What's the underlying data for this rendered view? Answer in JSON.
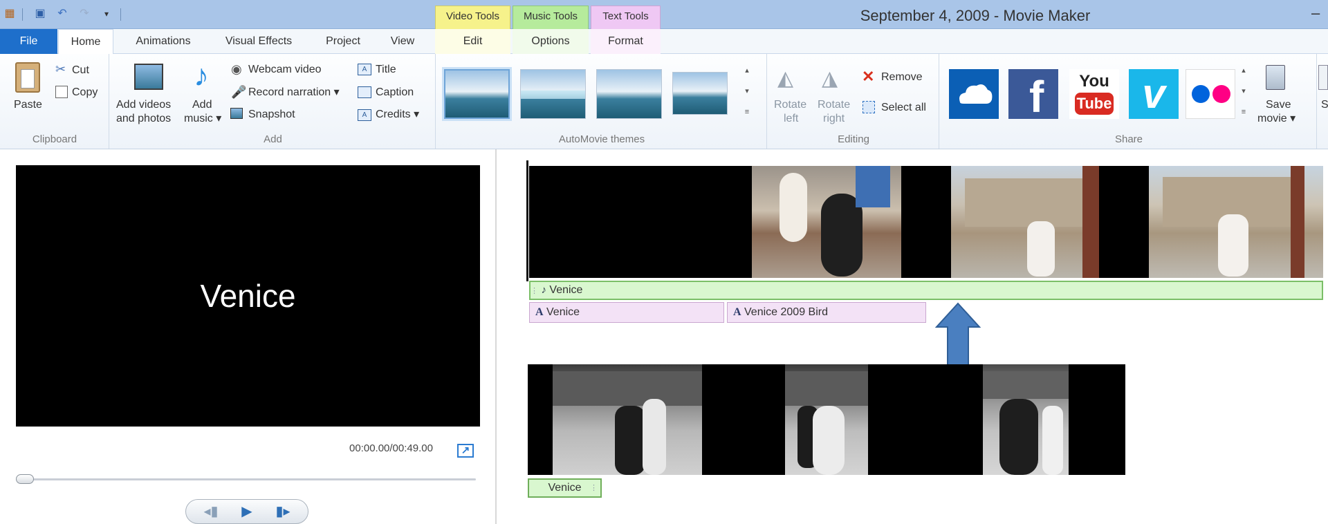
{
  "window": {
    "title": "September 4, 2009 - Movie Maker",
    "minimize": "–"
  },
  "context_tabs": {
    "video_tools": "Video Tools",
    "music_tools": "Music Tools",
    "text_tools": "Text Tools"
  },
  "tabs": [
    "File",
    "Home",
    "Animations",
    "Visual Effects",
    "Project",
    "View",
    "Edit",
    "Options",
    "Format"
  ],
  "ribbon": {
    "clipboard": {
      "paste": "Paste",
      "cut": "Cut",
      "copy": "Copy",
      "group": "Clipboard"
    },
    "add": {
      "add_videos_line1": "Add videos",
      "add_videos_line2": "and photos",
      "add_music_line1": "Add",
      "add_music_line2": "music ▾",
      "webcam": "Webcam video",
      "record_narration": "Record narration ▾",
      "snapshot": "Snapshot",
      "title": "Title",
      "caption": "Caption",
      "credits": "Credits ▾",
      "group": "Add"
    },
    "themes": {
      "group": "AutoMovie themes"
    },
    "editing": {
      "rotate_left_1": "Rotate",
      "rotate_left_2": "left",
      "rotate_right_1": "Rotate",
      "rotate_right_2": "right",
      "remove": "Remove",
      "select_all": "Select all",
      "group": "Editing"
    },
    "share": {
      "save_movie_1": "Save",
      "save_movie_2": "movie ▾",
      "sign_in": "S",
      "group": "Share",
      "youtube_1": "You",
      "youtube_2": "Tube"
    }
  },
  "preview": {
    "overlay_text": "Venice",
    "time": "00:00.00/00:49.00",
    "seek_fraction": 0.0
  },
  "timeline": {
    "music_label": "Venice",
    "text_items": [
      "Venice",
      "Venice 2009 Bird"
    ],
    "caption_label": "Venice"
  },
  "colors": {
    "file_tab": "#1e6fcb",
    "video_tools": "#f6f28b",
    "music_tools": "#b6eb9c",
    "text_tools": "#efc8f4",
    "arrow": "#4a7fc0"
  }
}
